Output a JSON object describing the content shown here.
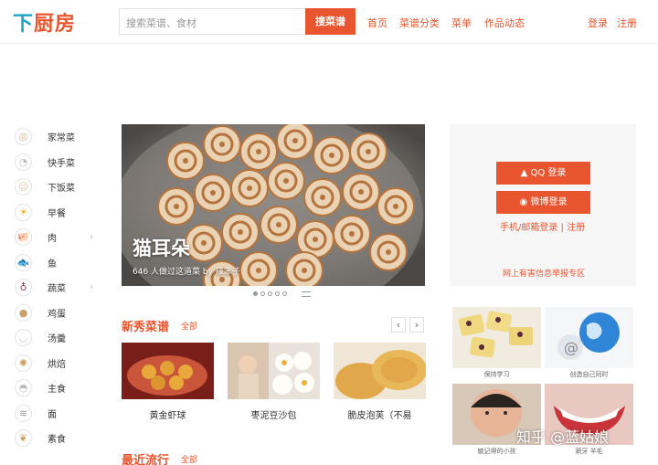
{
  "header": {
    "logo_chars": [
      "下",
      "厨",
      "房"
    ],
    "search_placeholder": "搜索菜谱、食材",
    "search_button": "搜菜谱",
    "nav": [
      "首页",
      "菜谱分类",
      "菜单",
      "作品动态"
    ],
    "login": "登录",
    "register": "注册"
  },
  "sidebar": {
    "items": [
      {
        "label": "家常菜",
        "icon": "plate-icon",
        "glyph": "◎",
        "color": "#c8b48a",
        "arrow": false
      },
      {
        "label": "快手菜",
        "icon": "clock-icon",
        "glyph": "◔",
        "color": "#bbbbbb",
        "arrow": false
      },
      {
        "label": "下饭菜",
        "icon": "smile-icon",
        "glyph": "☺",
        "color": "#d9c9a0",
        "arrow": false
      },
      {
        "label": "早餐",
        "icon": "sun-icon",
        "glyph": "☀",
        "color": "#f0b32a",
        "arrow": false
      },
      {
        "label": "肉",
        "icon": "pig-icon",
        "glyph": "🐖",
        "color": "#d98a7a",
        "arrow": true
      },
      {
        "label": "鱼",
        "icon": "fish-icon",
        "glyph": "🐟",
        "color": "#d9a47a",
        "arrow": false
      },
      {
        "label": "蔬菜",
        "icon": "onion-icon",
        "glyph": "♁",
        "color": "#8a3a6a",
        "arrow": true
      },
      {
        "label": "鸡蛋",
        "icon": "egg-icon",
        "glyph": "●",
        "color": "#c9a06a",
        "arrow": false
      },
      {
        "label": "汤羹",
        "icon": "bowl-icon",
        "glyph": "◡",
        "color": "#bbbbbb",
        "arrow": false
      },
      {
        "label": "烘焙",
        "icon": "cookie-icon",
        "glyph": "✺",
        "color": "#c8a060",
        "arrow": false
      },
      {
        "label": "主食",
        "icon": "rice-icon",
        "glyph": "◓",
        "color": "#bbbbbb",
        "arrow": false
      },
      {
        "label": "面",
        "icon": "noodle-icon",
        "glyph": "≋",
        "color": "#999999",
        "arrow": false
      },
      {
        "label": "素食",
        "icon": "wheat-icon",
        "glyph": "❦",
        "color": "#c8a060",
        "arrow": false
      }
    ]
  },
  "banner": {
    "title": "猫耳朵",
    "subtitle": "646 人做过这道菜    by 辣笨子"
  },
  "login_panel": {
    "qq": "QQ 登录",
    "weibo": "微博登录",
    "links": "手机/邮箱登录  |  注册",
    "report": "网上有害信息举报专区"
  },
  "section_new": {
    "title": "新秀菜谱",
    "more": "全部"
  },
  "section_trend": {
    "title": "最近流行",
    "more": "全部"
  },
  "cards": [
    {
      "name": "黄金虾球"
    },
    {
      "name": "枣泥豆沙包"
    },
    {
      "name": "脆皮泡芙（不易"
    }
  ],
  "ads": [
    {
      "caption": "保持学习"
    },
    {
      "caption": "创造自己同时"
    },
    {
      "caption": "毓记得的小孩"
    },
    {
      "caption": "蔬牙 羊毛"
    }
  ],
  "watermark": "知乎 @蓝姑娘"
}
